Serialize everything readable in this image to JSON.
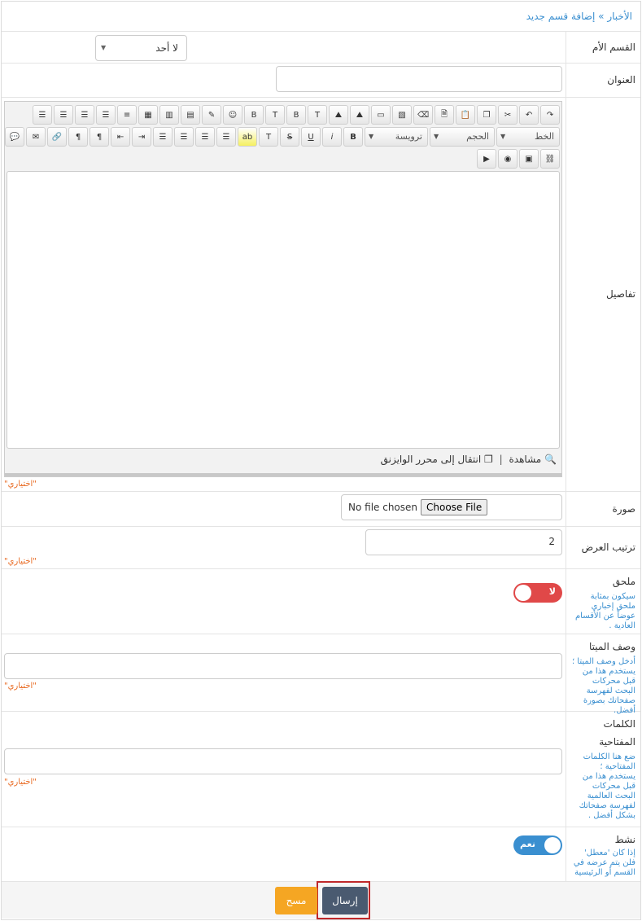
{
  "breadcrumb": {
    "parent": "الأخبار",
    "sep": "»",
    "current": "إضافة قسم جديد"
  },
  "parent_section": {
    "label": "القسم الأم",
    "value": "لا أحد"
  },
  "title_field": {
    "label": "العنوان",
    "value": ""
  },
  "details": {
    "label": "تفاصيل",
    "toolbar": {
      "font_label": "الخط",
      "size_label": "الحجم",
      "heading_label": "ترويسة"
    },
    "preview_label": "مشاهدة",
    "wysiwyg_label": "انتقال إلى محرر الوايزنق",
    "optional": "\"اختياري\""
  },
  "image": {
    "label": "صورة",
    "button": "Choose File",
    "status": "No file chosen"
  },
  "order": {
    "label": "ترتيب العرض",
    "value": "2",
    "optional": "\"اختياري\""
  },
  "attached": {
    "label": "ملحق",
    "help": "سيكون بمثابة ملحق إخباري عوضاً عن الأقسام العادية .",
    "toggle_text": "لا",
    "toggle_color": "#e04848"
  },
  "meta": {
    "label": "وصف الميتا",
    "help": "أدخل وصف الميتا ؛ يستخدم هذا من قبل محركات البحث لفهرسة صفحاتك بصورة أفضل.",
    "optional": "\"اختياري\""
  },
  "keywords": {
    "label1": "الكلمات",
    "label2": "المفتاحية",
    "help": "ضع هنا الكلمات المفتاحية ؛ يستخدم هذا من قبل محركات البحث العالمية لفهرسة صفحاتك بشكل أفضل .",
    "optional": "\"اختياري\""
  },
  "active": {
    "label": "نشط",
    "help": "إذا كان 'معطل' فلن يتم عرضه في القسم أو الرئيسية",
    "toggle_text": "نعم",
    "toggle_color": "#3a8fd0"
  },
  "actions": {
    "submit": "إرسال",
    "clear": "مسح",
    "submit_color": "#4a5a70",
    "clear_color": "#f5a623"
  }
}
